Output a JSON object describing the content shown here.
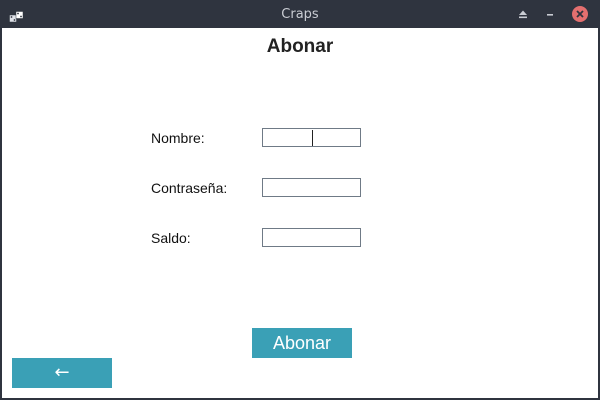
{
  "window": {
    "title": "Craps",
    "app_icon": "dice-icon",
    "controls": {
      "eject_icon": "eject-icon",
      "minimize_icon": "minimize-icon",
      "close_icon": "close-icon"
    }
  },
  "form": {
    "heading": "Abonar",
    "fields": [
      {
        "label": "Nombre:",
        "value": ""
      },
      {
        "label": "Contraseña:",
        "value": ""
      },
      {
        "label": "Saldo:",
        "value": ""
      }
    ],
    "submit_label": "Abonar",
    "back_label": "←"
  },
  "colors": {
    "accent": "#3aa0b6",
    "titlebar": "#2f343f",
    "close": "#e46f6f"
  }
}
